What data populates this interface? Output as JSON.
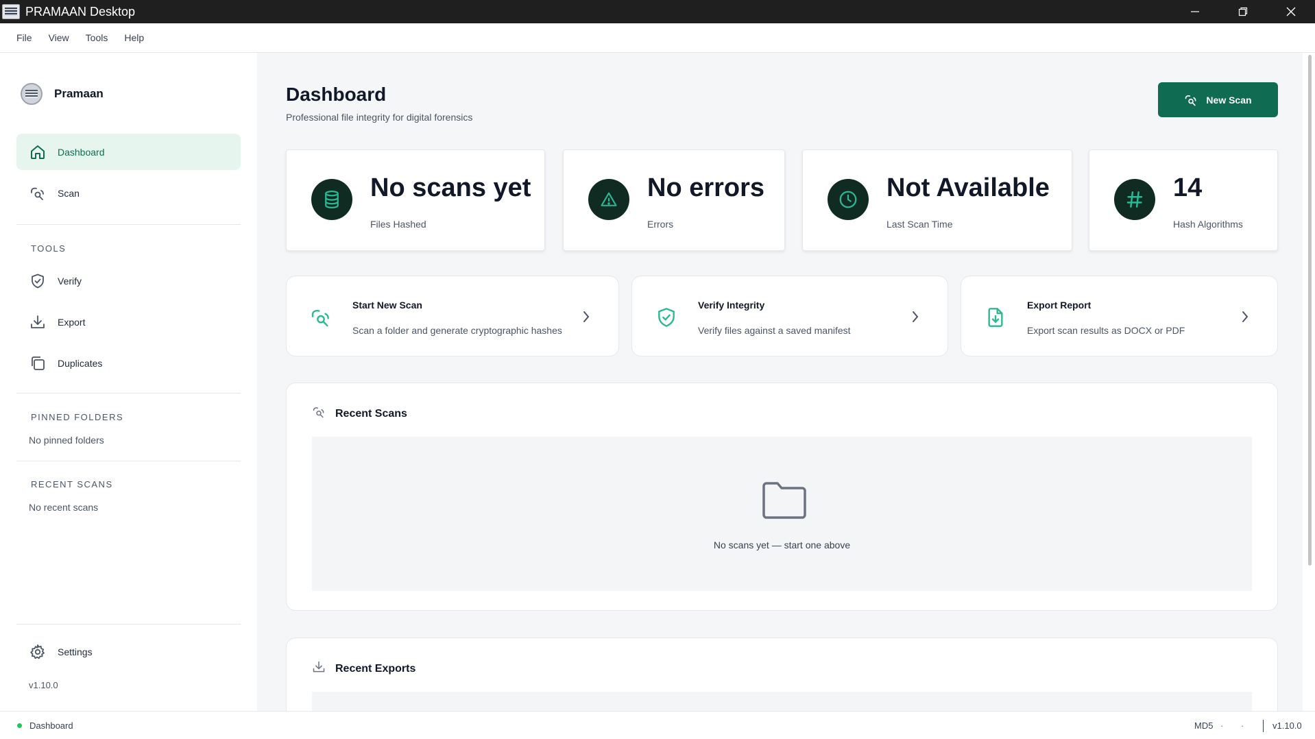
{
  "window": {
    "title": "PRAMAAN Desktop"
  },
  "menu": {
    "items": [
      "File",
      "View",
      "Tools",
      "Help"
    ]
  },
  "sidebar": {
    "brand": "Pramaan",
    "nav": [
      {
        "label": "Dashboard",
        "icon": "home-icon",
        "active": true
      },
      {
        "label": "Scan",
        "icon": "scan-icon",
        "active": false
      }
    ],
    "tools_heading": "TOOLS",
    "tools": [
      {
        "label": "Verify",
        "icon": "shield-check-icon"
      },
      {
        "label": "Export",
        "icon": "download-icon"
      },
      {
        "label": "Duplicates",
        "icon": "copy-icon"
      }
    ],
    "pinned_heading": "PINNED FOLDERS",
    "pinned_empty": "No pinned folders",
    "recent_heading": "RECENT SCANS",
    "recent_empty": "No recent scans",
    "settings_label": "Settings",
    "version": "v1.10.0"
  },
  "main": {
    "title": "Dashboard",
    "subtitle": "Professional file integrity for digital forensics",
    "new_scan_label": "New Scan",
    "stats": [
      {
        "value": "No scans yet",
        "label": "Files Hashed",
        "icon": "database-icon"
      },
      {
        "value": "No errors",
        "label": "Errors",
        "icon": "warning-icon"
      },
      {
        "value": "Not Available",
        "label": "Last Scan Time",
        "icon": "clock-icon"
      },
      {
        "value": "14",
        "label": "Hash Algorithms",
        "icon": "hash-icon"
      }
    ],
    "actions": [
      {
        "title": "Start New Scan",
        "desc": "Scan a folder and generate cryptographic hashes",
        "icon": "scan-icon"
      },
      {
        "title": "Verify Integrity",
        "desc": "Verify files against a saved manifest",
        "icon": "shield-check-icon"
      },
      {
        "title": "Export Report",
        "desc": "Export scan results as DOCX or PDF",
        "icon": "file-download-icon"
      }
    ],
    "recent_scans": {
      "title": "Recent Scans",
      "empty": "No scans yet — start one above"
    },
    "recent_exports": {
      "title": "Recent Exports"
    }
  },
  "status": {
    "page": "Dashboard",
    "algorithm": "MD5",
    "dot1": "·",
    "dot2": "·",
    "version": "v1.10.0"
  },
  "colors": {
    "accent": "#0f6b52",
    "accent_light": "#e6f6ef",
    "icon_teal": "#2bb894",
    "stat_icon_bg": "#0f2b22"
  }
}
